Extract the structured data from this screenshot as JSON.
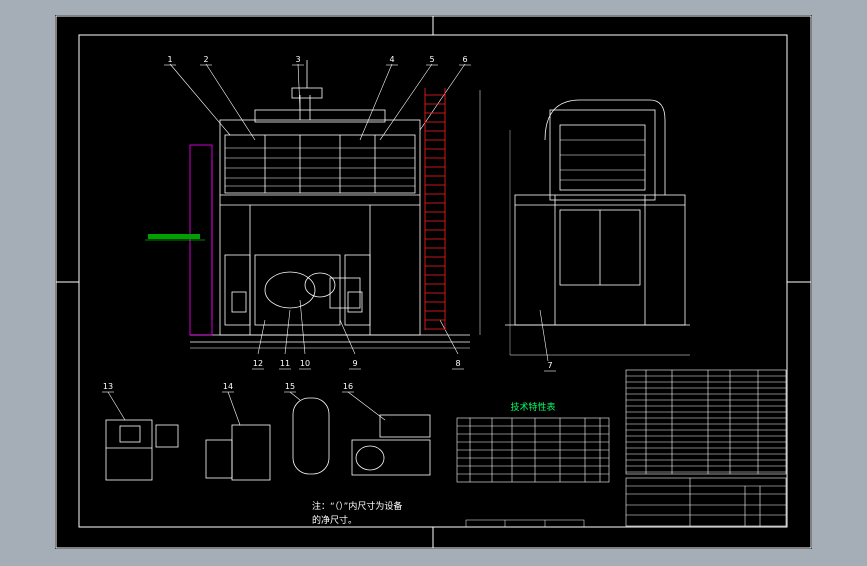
{
  "drawing": {
    "background": "#000000",
    "viewport_bg": "#a5aeb6",
    "line_color": "#ffffff",
    "accent_red": "#ff2020",
    "accent_magenta": "#ff00ff",
    "accent_green": "#00ff00",
    "accent_cyan": "#00ffff",
    "accent_yellow": "#ffff00"
  },
  "callouts_front": [
    "1",
    "2",
    "3",
    "4",
    "5",
    "6"
  ],
  "callouts_bottom": [
    "12",
    "11",
    "10",
    "9",
    "8"
  ],
  "callout_side": "7",
  "callouts_aux": [
    "13",
    "14",
    "15",
    "16"
  ],
  "table_title": "技术特性表",
  "note_line1": "注：“（）”内尺寸为设备",
  "note_line2": "的净尺寸。"
}
